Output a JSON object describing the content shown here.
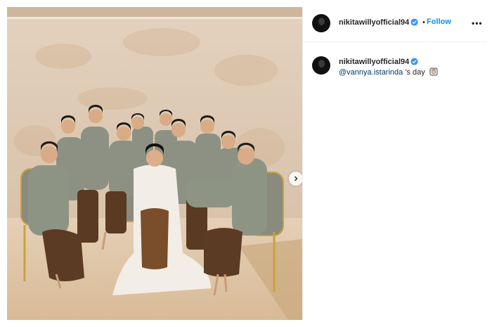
{
  "post": {
    "username": "nikitawillyofficial94",
    "follow_label": "Follow",
    "separator": "•",
    "more_label": "•••"
  },
  "comment": {
    "username": "nikitawillyofficial94",
    "mention": "@vannya.istarinda",
    "text_after": " 's day"
  },
  "icons": {
    "verified": "verified-badge-icon",
    "next": "chevron-right-icon",
    "emoji": "bride-emoji-icon"
  },
  "colors": {
    "accent": "#0095f6",
    "verified": "#3897f0",
    "mention": "#00376b"
  }
}
